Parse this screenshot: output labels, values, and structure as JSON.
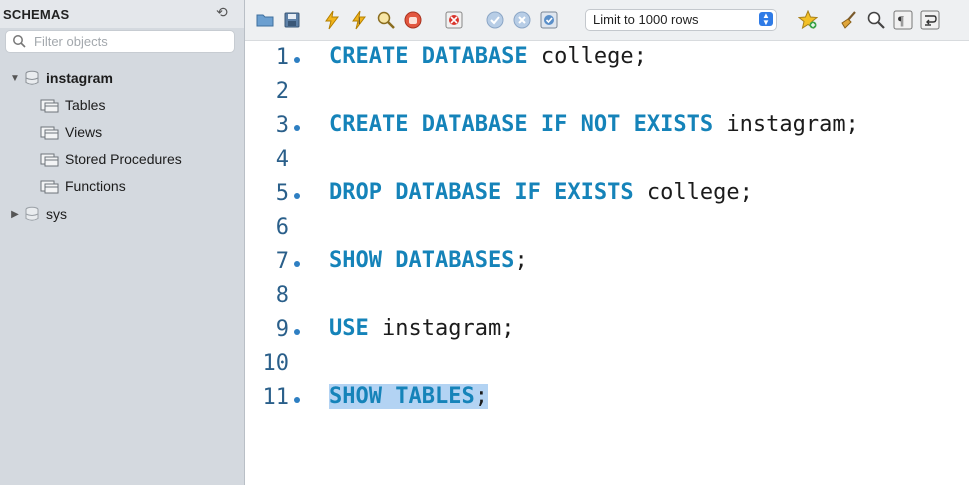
{
  "sidebar": {
    "header": "SCHEMAS",
    "filter_placeholder": "Filter objects",
    "schemas": [
      {
        "name": "instagram",
        "expanded": true,
        "children": [
          "Tables",
          "Views",
          "Stored Procedures",
          "Functions"
        ]
      },
      {
        "name": "sys",
        "expanded": false
      }
    ]
  },
  "toolbar": {
    "limit_label": "Limit to 1000 rows",
    "icons": [
      "open-folder-icon",
      "save-icon",
      "execute-icon",
      "execute-current-icon",
      "explain-icon",
      "stop-icon",
      "toggle-error-icon",
      "commit-icon",
      "rollback-icon",
      "autocommit-icon",
      "beautify-star-icon",
      "broom-icon",
      "find-icon",
      "invisible-chars-icon",
      "wrap-icon"
    ]
  },
  "editor": {
    "lines": [
      {
        "n": "1",
        "dot": true,
        "kw": "CREATE DATABASE",
        "rest": " college;"
      },
      {
        "n": "2",
        "dot": false,
        "kw": "",
        "rest": ""
      },
      {
        "n": "3",
        "dot": true,
        "kw": "CREATE DATABASE IF NOT EXISTS",
        "rest": " instagram;"
      },
      {
        "n": "4",
        "dot": false,
        "kw": "",
        "rest": ""
      },
      {
        "n": "5",
        "dot": true,
        "kw": "DROP DATABASE IF EXISTS",
        "rest": " college;"
      },
      {
        "n": "6",
        "dot": false,
        "kw": "",
        "rest": ""
      },
      {
        "n": "7",
        "dot": true,
        "kw": "SHOW DATABASES",
        "rest": ";"
      },
      {
        "n": "8",
        "dot": false,
        "kw": "",
        "rest": ""
      },
      {
        "n": "9",
        "dot": true,
        "kw": "USE",
        "rest": " instagram;"
      },
      {
        "n": "10",
        "dot": false,
        "kw": "",
        "rest": ""
      },
      {
        "n": "11",
        "dot": true,
        "kw": "SHOW TABLES",
        "rest": ";"
      }
    ],
    "selected_line": "11"
  },
  "colors": {
    "keyword": "#1583b9",
    "line_number": "#2a5f8a",
    "selection": "#b3d3f3",
    "sidebar_bg": "#d4d9df"
  }
}
